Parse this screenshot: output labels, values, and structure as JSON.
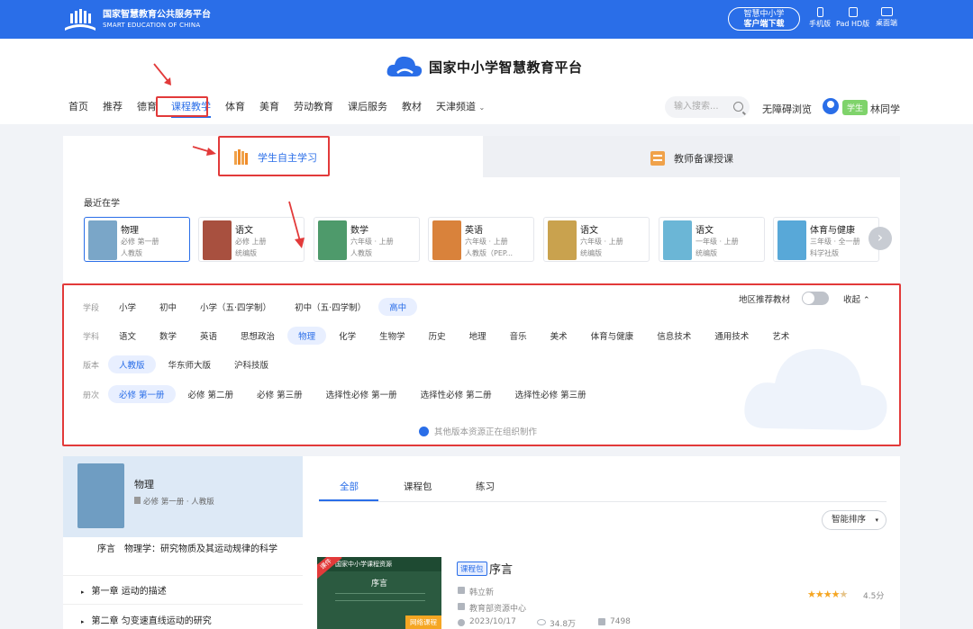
{
  "topbar": {
    "org_cn": "国家智慧教育公共服务平台",
    "org_en": "SMART EDUCATION OF CHINA",
    "download_line1": "智慧中小学",
    "download_line2": "客户端下载",
    "devices": [
      "手机版",
      "Pad HD版",
      "桌面端"
    ]
  },
  "header": {
    "logo_text": "国家中小学智慧教育平台",
    "nav": [
      "首页",
      "推荐",
      "德育",
      "课程教学",
      "体育",
      "美育",
      "劳动教育",
      "课后服务",
      "教材",
      "天津频道"
    ],
    "search_placeholder": "输入搜索...",
    "accessibility": "无障碍浏览",
    "role_badge": "学生",
    "username": "林同学"
  },
  "modes": {
    "student": "学生自主学习",
    "teacher": "教师备课授课"
  },
  "recent": {
    "title": "最近在学",
    "cards": [
      {
        "title": "物理",
        "line1": "必修 第一册",
        "line2": "人教版",
        "color": "#7aa6c8"
      },
      {
        "title": "语文",
        "line1": "必修 上册",
        "line2": "统编版",
        "color": "#a8503f"
      },
      {
        "title": "数学",
        "line1": "六年级 · 上册",
        "line2": "人教版",
        "color": "#4e9a6b"
      },
      {
        "title": "英语",
        "line1": "六年级 · 上册",
        "line2": "人教版（PEP...",
        "color": "#d9823b"
      },
      {
        "title": "语文",
        "line1": "六年级 · 上册",
        "line2": "统编版",
        "color": "#c9a24e"
      },
      {
        "title": "语文",
        "line1": "一年级 · 上册",
        "line2": "统编版",
        "color": "#6bb6d6"
      },
      {
        "title": "体育与健康",
        "line1": "三年级 · 全一册",
        "line2": "科学社版",
        "color": "#58a8d8"
      }
    ]
  },
  "filters": {
    "region_toggle": "地区推荐教材",
    "collapse": "收起",
    "rows": [
      {
        "label": "学段",
        "options": [
          "小学",
          "初中",
          "小学（五·四学制）",
          "初中（五·四学制）",
          "高中"
        ],
        "selected": 4
      },
      {
        "label": "学科",
        "options": [
          "语文",
          "数学",
          "英语",
          "思想政治",
          "物理",
          "化学",
          "生物学",
          "历史",
          "地理",
          "音乐",
          "美术",
          "体育与健康",
          "信息技术",
          "通用技术",
          "艺术"
        ],
        "selected": 4
      },
      {
        "label": "版本",
        "options": [
          "人教版",
          "华东师大版",
          "沪科技版"
        ],
        "selected": 0
      },
      {
        "label": "册次",
        "options": [
          "必修 第一册",
          "必修 第二册",
          "必修 第三册",
          "选择性必修 第一册",
          "选择性必修 第二册",
          "选择性必修 第三册"
        ],
        "selected": 0
      }
    ],
    "notice": "其他版本资源正在组织制作"
  },
  "book": {
    "title": "物理",
    "subtitle": "必修 第一册 · 人教版",
    "chapters": [
      "序言　物理学：研究物质及其运动规律的科学",
      "第一章 运动的描述",
      "第二章 匀变速直线运动的研究"
    ]
  },
  "content": {
    "tabs": [
      "全部",
      "课程包",
      "练习"
    ],
    "sort": "智能排序",
    "item": {
      "tag": "课程包",
      "title": "序言",
      "author": "韩立新",
      "source": "教育部资源中心",
      "date": "2023/10/17",
      "views": "34.8万",
      "likes": "7498",
      "rating": "4.5分",
      "thumb_header": "国家中小学课程资源",
      "thumb_title": "序言",
      "thumb_corner": "课件",
      "thumb_badge": "网络课程"
    }
  }
}
